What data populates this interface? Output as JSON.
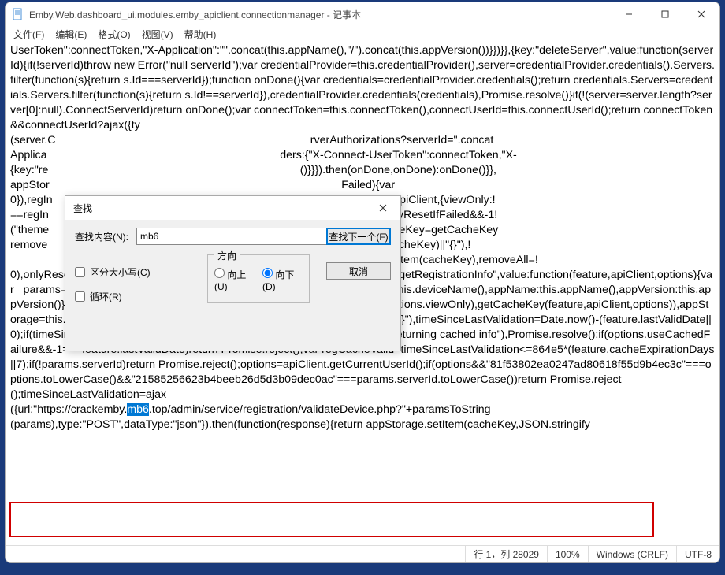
{
  "window": {
    "title": "Emby.Web.dashboard_ui.modules.emby_apiclient.connectionmanager - 记事本"
  },
  "menubar": {
    "file": "文件(F)",
    "edit": "编辑(E)",
    "format": "格式(O)",
    "view": "视图(V)",
    "help": "帮助(H)"
  },
  "content": {
    "block1": "UserToken\":connectToken,\"X-Application\":\"\".concat(this.appName(),\"/\").concat(this.appVersion())}})}},{key:\"deleteServer\",value:function(serverId){if(!serverId)throw new Error(\"null serverId\");var credentialProvider=this.credentialProvider(),server=credentialProvider.credentials().Servers.filter(function(s){return s.Id===serverId});function onDone(){var credentials=credentialProvider.credentials();return credentials.Servers=credentials.Servers.filter(function(s){return s.Id!==serverId}),credentialProvider.credentials(credentials),Promise.resolve()}if(!(server=server.length?server[0]:null).ConnectServerId)return onDone();var connectToken=this.connectToken(),connectUserId=this.connectUserId();return connectToken&&connectUserId?ajax({ty",
    "right1": "rverAuthorizations?serverId=\".concat",
    "right2": "ders:{\"X-Connect-UserToken\":connectToken,\"X-",
    "right3": "()}}}).then(onDone,onDone):onDone()}},",
    "right4": "Failed){var",
    "right5": "Key(\"themes\",apiClient,{viewOnly:!",
    "right6": "noveAll&&onlyResetIfFailed&&-1!",
    "right7": "moveAll=!0),cacheKey=getCacheKey",
    "right8": "ge.getItem(cacheKey)||\"{}\"),!",
    "right9": "ppStorage.removeItem(cacheKey),removeAll=!",
    "block2": "0),onlyResetIfFailed||_events.default.trigger(this,\"resetregistrationinfo\")}},{key:\"getRegistrationInfo\",value:function(feature,apiClient,options){var _params={serverId:apiClient.serverId(),deviceId:this.deviceId(),deviceName:this.deviceName(),appName:this.appName(),appVersion:this.appVersion()},cacheKey=((options=options||{}).viewOnly&&(params.viewOnly=options.viewOnly),getCacheKey(feature,apiClient,options)),appStorage=this.appStorage,feature=JSON.parse(appStorage.getItem(cacheKey)||\"{}\"),timeSinceLastValidation=Date.now()-(feature.lastValidDate||0);if(timeSinceLastValidation<=864e5)return console.log(\"getRegistrationInfo returning cached info\"),Promise.resolve();if(options.useCachedFailure&&-1===feature.lastValidDate)return Promise.reject();var regCacheValid=timeSinceLastValidation<=864e5*(feature.cacheExpirationDays||7);if(!params.serverId)return Promise.reject();options=apiClient.getCurrentUserId();if(options&&\"81f53802ea0247ad80618f55d9b4ec3c\"===options.toLowerCase()&&\"21585256623b4beeb26d5d3b09dec0ac\"===params.serverId.toLowerCase())return Promise.reject",
    "inbox1": "();timeSinceLastValidation=ajax",
    "inbox2a": "({url:\"https://crackemby.",
    "sel": "mb6",
    "inbox2b": ".top/admin/service/registration/validateDevice.php?\"+paramsToString",
    "after": "(params),type:\"POST\",dataType:\"json\"}).then(function(response){return appStorage.setItem(cacheKey,JSON.stringify",
    "left1": "(server.C",
    "left2": "Applica",
    "left3": "{key:\"re",
    "left4": "appStor",
    "left5": "0}),regIn",
    "left6": "==regIn",
    "left7": "(\"theme",
    "left8": "remove"
  },
  "dialog": {
    "title": "查找",
    "label": "查找内容(N):",
    "value": "mb6",
    "findNext": "查找下一个(F)",
    "cancel": "取消",
    "direction": "方向",
    "up": "向上(U)",
    "down": "向下(D)",
    "matchCase": "区分大小写(C)",
    "wrap": "循环(R)"
  },
  "statusbar": {
    "pos": "行 1，列 28029",
    "zoom": "100%",
    "eol": "Windows (CRLF)",
    "enc": "UTF-8"
  }
}
